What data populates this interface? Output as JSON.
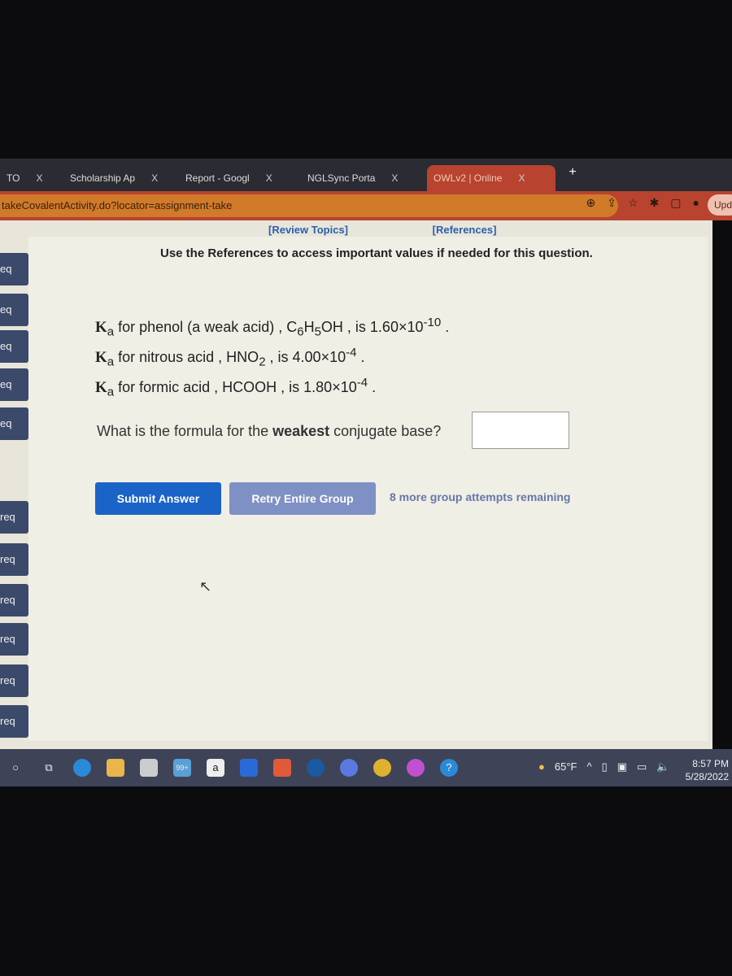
{
  "browser": {
    "tabs": [
      {
        "title": "TO",
        "active": false
      },
      {
        "title": "Scholarship Ap",
        "active": false
      },
      {
        "title": "Report - Googl",
        "active": false
      },
      {
        "title": "NGLSync Porta",
        "active": false
      },
      {
        "title": "OWLv2 | Online",
        "active": true
      }
    ],
    "close_glyph": "X",
    "new_tab": "+",
    "url": "takeCovalentActivity.do?locator=assignment-take",
    "update_label": "Upd",
    "accent": "#b8432f"
  },
  "page": {
    "links": [
      "[Review Topics]",
      "[References]"
    ],
    "note": "Use the References to access important values if needed for this question.",
    "sidebar": [
      "eq",
      "eq",
      "eq",
      "eq",
      "eq",
      "req",
      "req",
      "req",
      "req",
      "req",
      "req"
    ],
    "ka_lines": [
      {
        "pre": " for phenol (a weak acid) , C",
        "f": [
          [
            "6",
            "H"
          ],
          [
            "5",
            "OH"
          ]
        ],
        "mant": " , is 1.60×10",
        "exp": "-10"
      },
      {
        "pre": " for nitrous acid , HNO",
        "f": [
          [
            "2",
            ""
          ]
        ],
        "mant": " , is 4.00×10",
        "exp": "-4"
      },
      {
        "pre": " for formic acid , HCOOH",
        "f": [],
        "mant": " , is 1.80×10",
        "exp": "-4"
      }
    ],
    "ka_symbol": "K",
    "ka_sub": "a",
    "question_pre": "What is the formula for the ",
    "question_bold": "weakest",
    "question_post": " conjugate base?",
    "answer_value": "",
    "submit_label": "Submit Answer",
    "retry_label": "Retry Entire Group",
    "attempts": "8 more group attempts remaining"
  },
  "taskbar": {
    "weather": "65°F",
    "time": "8:57 PM",
    "date": "5/28/2022",
    "badge": "99+"
  }
}
